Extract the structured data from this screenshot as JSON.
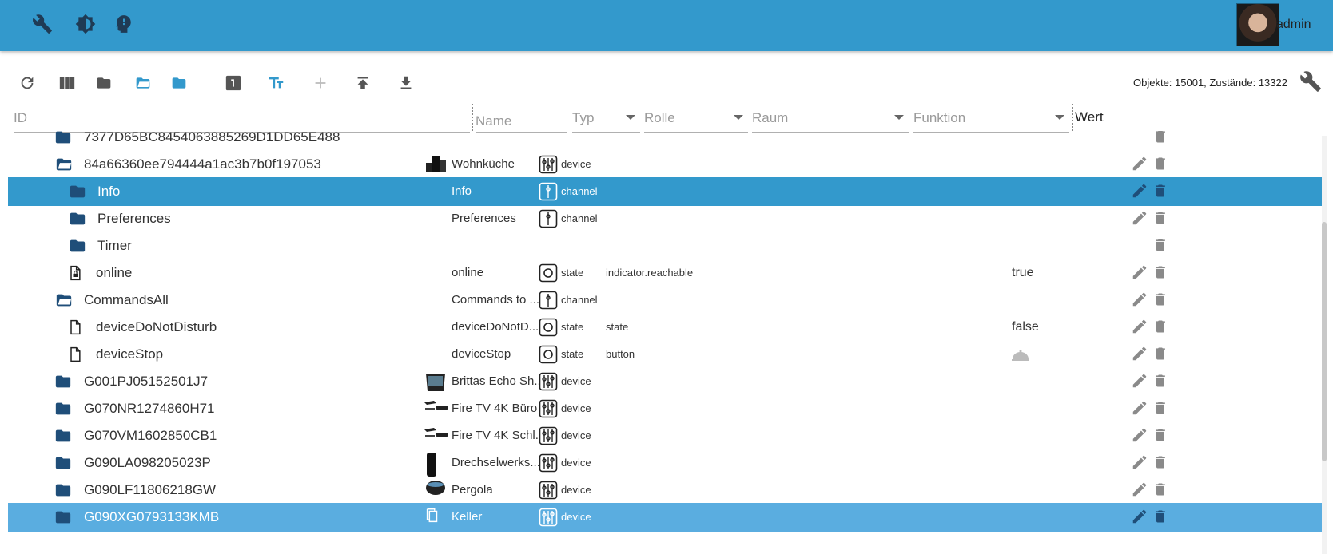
{
  "header": {
    "username": "admin"
  },
  "toolbar": {
    "counts_text": "Objekte: 15001, Zustände: 13322"
  },
  "filters": {
    "id_placeholder": "ID",
    "name_placeholder": "Name",
    "type_label": "Typ",
    "role_label": "Rolle",
    "room_label": "Raum",
    "function_label": "Funktion",
    "value_header": "Wert"
  },
  "colors": {
    "appbar": "#3399cc",
    "folder": "#1f4e79",
    "selected": "#3399cc"
  },
  "rows": [
    {
      "id": "7377D65BC8454063885269D1DD65E488",
      "name": "",
      "type": "",
      "role": "",
      "value": "",
      "icon": "folder-closed-icon",
      "level": 1,
      "thumb": "",
      "edit": false
    },
    {
      "id": "84a66360ee794444a1ac3b7b0f197053",
      "name": "Wohnküche",
      "type": "device",
      "role": "",
      "value": "",
      "icon": "folder-open-icon",
      "level": 1,
      "thumb": "echo-speakers",
      "edit": true
    },
    {
      "id": "Info",
      "name": "Info",
      "type": "channel",
      "role": "",
      "value": "",
      "icon": "folder-closed-icon",
      "level": 2,
      "thumb": "",
      "edit": true,
      "selected": true
    },
    {
      "id": "Preferences",
      "name": "Preferences",
      "type": "channel",
      "role": "",
      "value": "",
      "icon": "folder-closed-icon",
      "level": 2,
      "thumb": "",
      "edit": true
    },
    {
      "id": "Timer",
      "name": "",
      "type": "",
      "role": "",
      "value": "",
      "icon": "folder-closed-icon",
      "level": 2,
      "thumb": "",
      "edit": false
    },
    {
      "id": "online",
      "name": "online",
      "type": "state",
      "role": "indicator.reachable",
      "value": "true",
      "icon": "file-lock-icon",
      "level": 2,
      "thumb": "",
      "edit": true
    },
    {
      "id": "CommandsAll",
      "name": "Commands to ...",
      "type": "channel",
      "role": "",
      "value": "",
      "icon": "folder-open-icon",
      "level": 1,
      "thumb": "",
      "edit": true
    },
    {
      "id": "deviceDoNotDisturb",
      "name": "deviceDoNotD...",
      "type": "state",
      "role": "state",
      "value": "false",
      "icon": "file-icon",
      "level": 2,
      "thumb": "",
      "edit": true
    },
    {
      "id": "deviceStop",
      "name": "deviceStop",
      "type": "state",
      "role": "button",
      "value": "",
      "icon": "file-icon",
      "level": 2,
      "thumb": "",
      "edit": true,
      "button": true
    },
    {
      "id": "G001PJ05152501J7",
      "name": "Brittas Echo Sh...",
      "type": "device",
      "role": "",
      "value": "",
      "icon": "folder-closed-icon",
      "level": 1,
      "thumb": "echo-show",
      "edit": true
    },
    {
      "id": "G070NR1274860H71",
      "name": "Fire TV 4K Büro",
      "type": "device",
      "role": "",
      "value": "",
      "icon": "folder-closed-icon",
      "level": 1,
      "thumb": "fire-tv",
      "edit": true
    },
    {
      "id": "G070VM1602850CB1",
      "name": "Fire TV 4K Schl...",
      "type": "device",
      "role": "",
      "value": "",
      "icon": "folder-closed-icon",
      "level": 1,
      "thumb": "fire-tv",
      "edit": true
    },
    {
      "id": "G090LA098205023P",
      "name": "Drechselwerks...",
      "type": "device",
      "role": "",
      "value": "",
      "icon": "folder-closed-icon",
      "level": 1,
      "thumb": "echo-tall",
      "edit": true
    },
    {
      "id": "G090LF11806218GW",
      "name": "Pergola",
      "type": "device",
      "role": "",
      "value": "",
      "icon": "folder-closed-icon",
      "level": 1,
      "thumb": "echo-dot",
      "edit": true
    },
    {
      "id": "G090XG0793133KMB",
      "name": "Keller",
      "type": "device",
      "role": "",
      "value": "",
      "icon": "folder-closed-icon",
      "level": 1,
      "thumb": "copy",
      "edit": true,
      "selected2": true
    }
  ]
}
